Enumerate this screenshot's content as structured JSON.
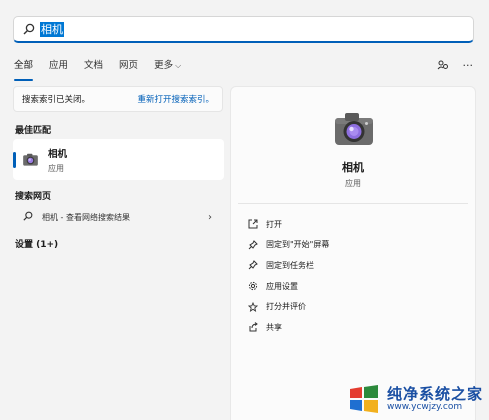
{
  "search": {
    "value": "相机"
  },
  "tabs": [
    {
      "label": "全部"
    },
    {
      "label": "应用"
    },
    {
      "label": "文档"
    },
    {
      "label": "网页"
    },
    {
      "label": "更多"
    }
  ],
  "index_notice": {
    "text": "搜索索引已关闭。",
    "link": "重新打开搜索索引。"
  },
  "best_match": {
    "heading": "最佳匹配",
    "title": "相机",
    "subtitle": "应用"
  },
  "web_search": {
    "heading": "搜索网页",
    "item": "相机 - 查看网络搜索结果"
  },
  "settings": {
    "heading": "设置 (1+)"
  },
  "detail": {
    "title": "相机",
    "subtitle": "应用",
    "actions": [
      {
        "label": "打开",
        "icon": "open-icon"
      },
      {
        "label": "固定到\"开始\"屏幕",
        "icon": "pin-icon"
      },
      {
        "label": "固定到任务栏",
        "icon": "pin-icon"
      },
      {
        "label": "应用设置",
        "icon": "gear-icon"
      },
      {
        "label": "打分并评价",
        "icon": "star-icon"
      },
      {
        "label": "共享",
        "icon": "share-icon"
      }
    ]
  },
  "watermark": {
    "main": "纯净系统之家",
    "sub": "www.ycwjzy.com"
  },
  "colors": {
    "accent": "#005fb8",
    "background": "#f3f3f3"
  }
}
